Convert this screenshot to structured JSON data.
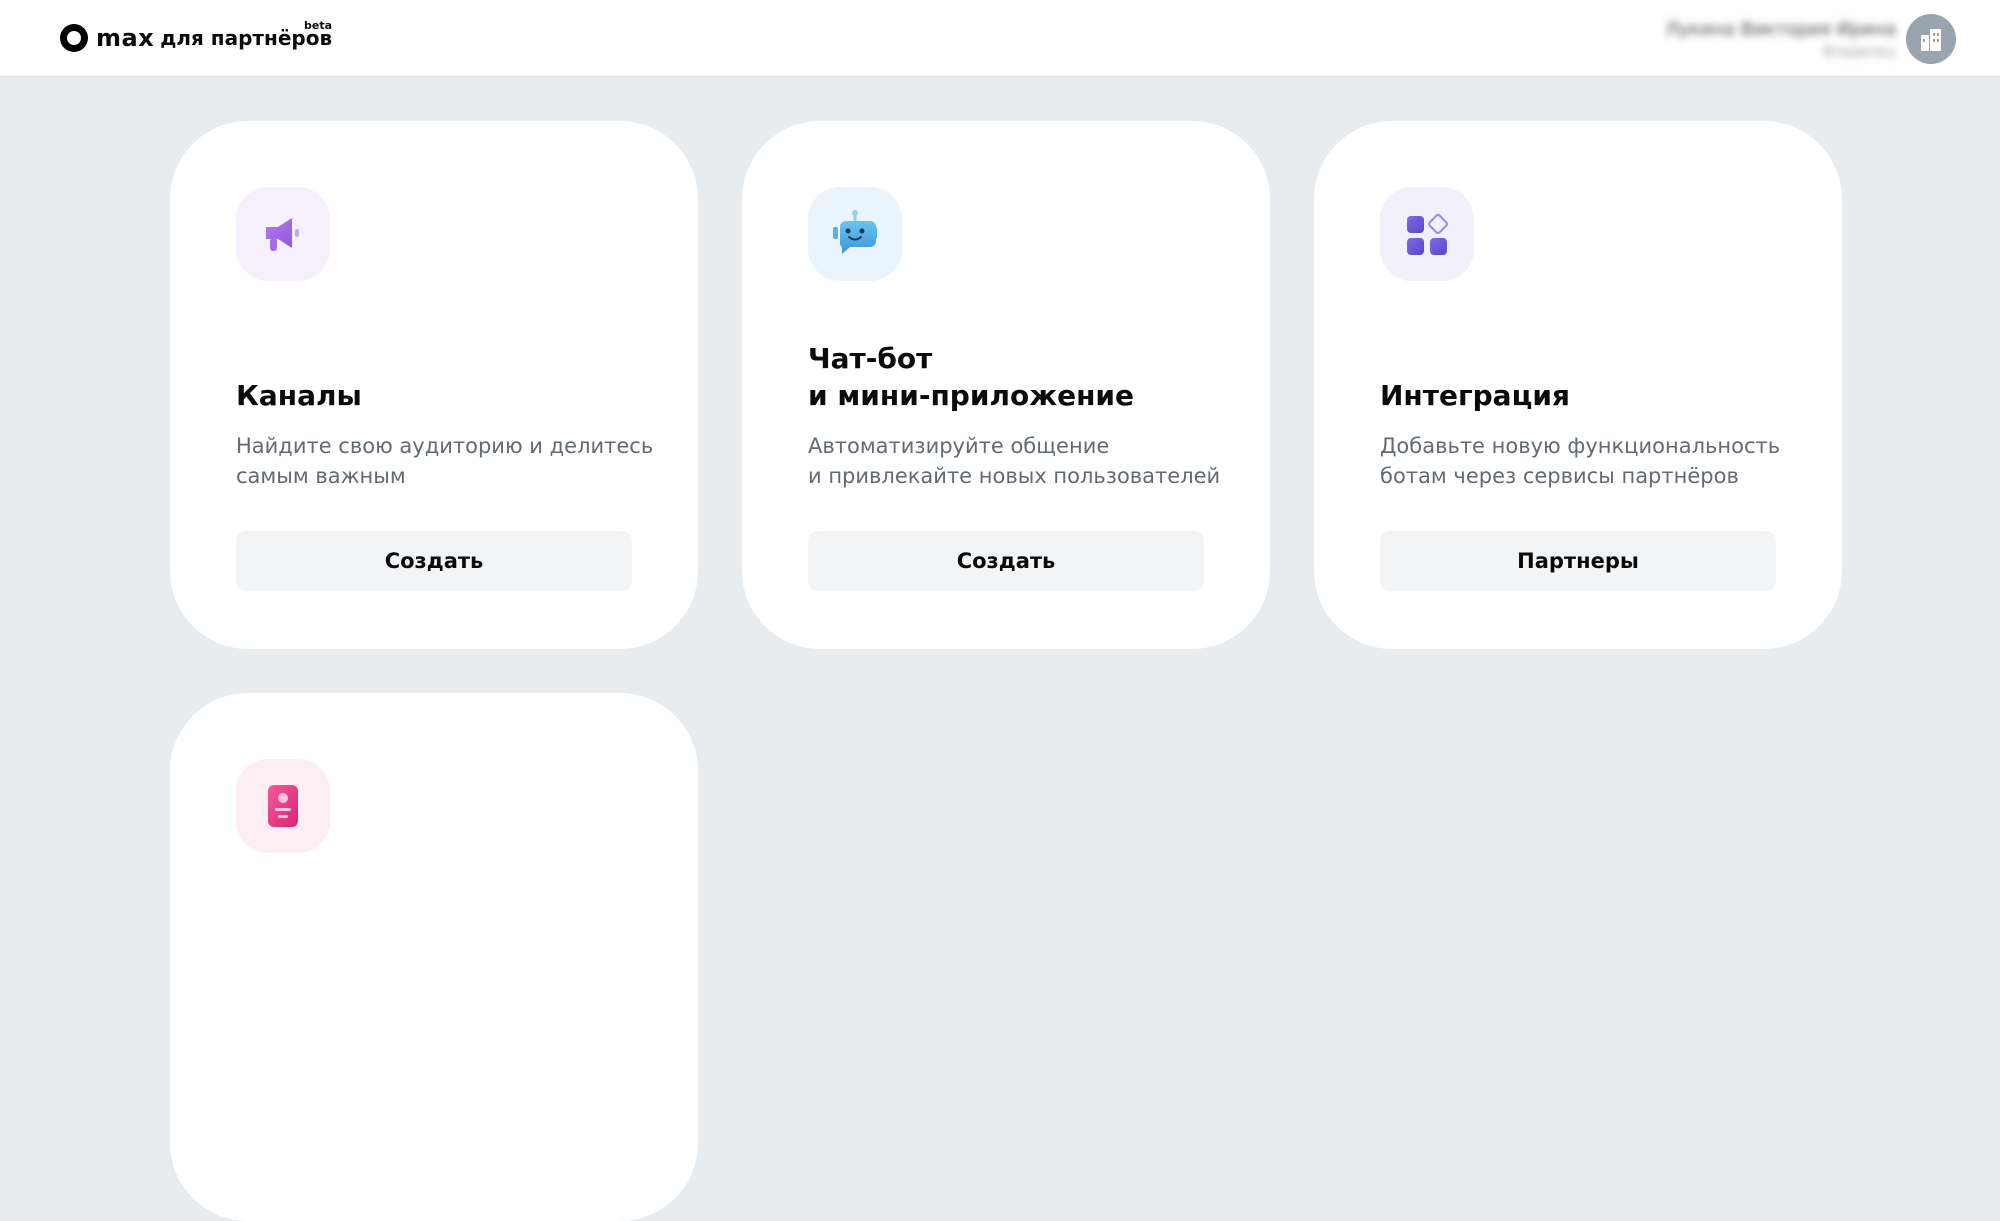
{
  "header": {
    "logo_max": "max",
    "logo_subtitle": "для партнёров",
    "logo_beta": "beta",
    "user_name": "Лукина Виктория Ирина",
    "user_role": "Владелец"
  },
  "cards": [
    {
      "title": "Каналы",
      "description": "Найдите свою аудиторию и делитесь\nсамым важным",
      "button": "Создать",
      "icon": "megaphone-icon",
      "icon_bg": "#f6f0fd"
    },
    {
      "title": "Чат-бот\nи мини-приложение",
      "description": "Автоматизируйте общение\nи привлекайте новых пользователей",
      "button": "Создать",
      "icon": "robot-icon",
      "icon_bg": "#eaf4fc"
    },
    {
      "title": "Интеграция",
      "description": "Добавьте новую функциональность\nботам через сервисы партнёров",
      "button": "Партнеры",
      "icon": "apps-grid-icon",
      "icon_bg": "#f1f0fb"
    },
    {
      "icon": "profile-card-icon",
      "icon_bg": "#fdeef3"
    }
  ],
  "colors": {
    "page_bg": "#e9ecef",
    "card_bg": "#ffffff",
    "button_bg": "#f3f4f6",
    "text_secondary": "#636a74"
  }
}
